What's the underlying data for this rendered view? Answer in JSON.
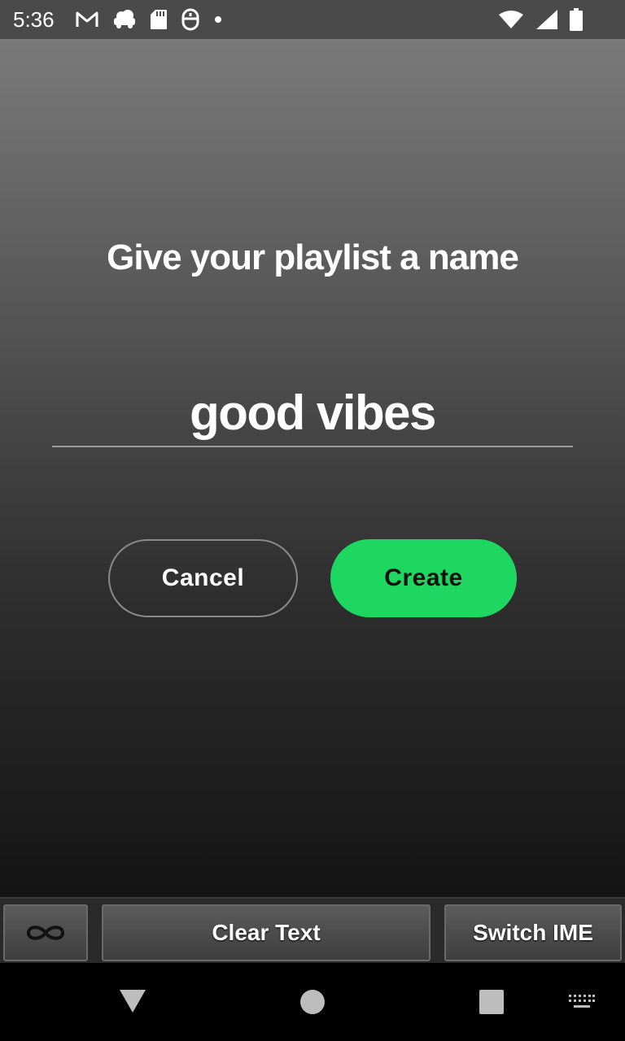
{
  "status_bar": {
    "time": "5:36",
    "left_icons": [
      "gmail-icon",
      "cloud-car-icon",
      "sd-card-icon",
      "accessibility-icon",
      "notification-dot-icon"
    ],
    "right_icons": [
      "wifi-icon",
      "cell-signal-icon",
      "battery-icon"
    ]
  },
  "dialog": {
    "title": "Give your playlist a name",
    "input_value": "good vibes",
    "cancel_label": "Cancel",
    "create_label": "Create"
  },
  "ime_toolbar": {
    "loop_icon": "infinity-icon",
    "clear_label": "Clear Text",
    "switch_label": "Switch IME"
  },
  "nav_bar": {
    "icons": [
      "back-icon",
      "home-icon",
      "recents-icon",
      "keyboard-icon"
    ]
  },
  "colors": {
    "accent": "#1ed760",
    "status_bar_bg": "#4a4a4a",
    "nav_bar_bg": "#000000"
  }
}
